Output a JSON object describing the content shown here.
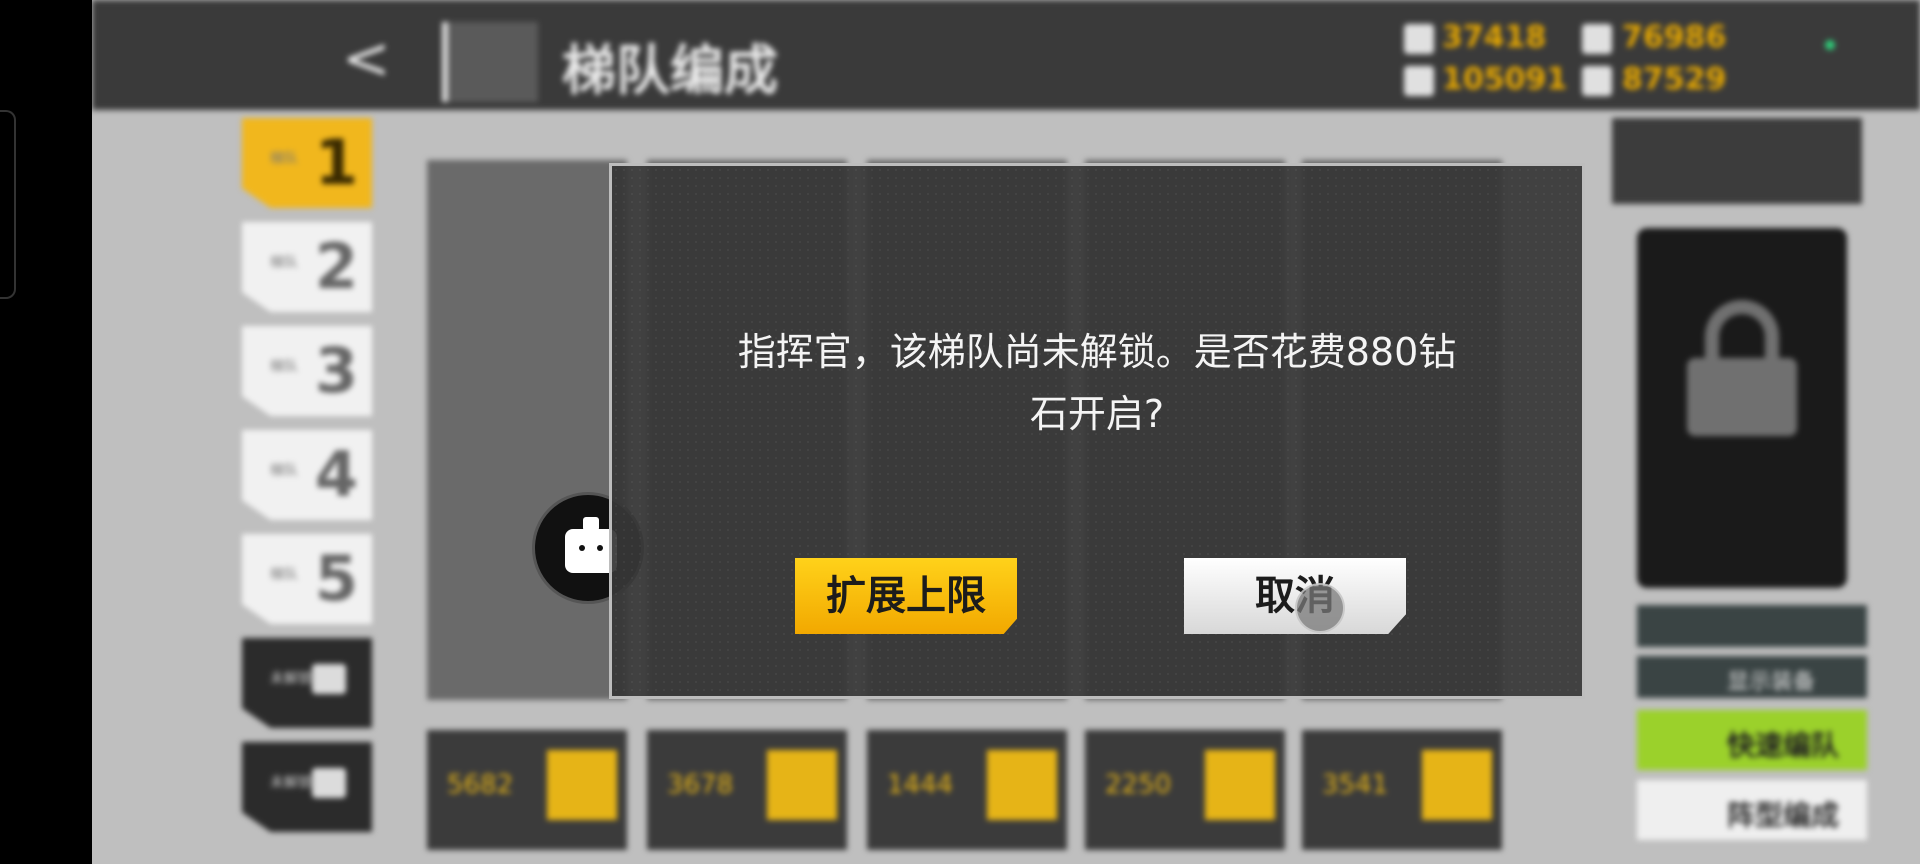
{
  "header": {
    "back_label": "<",
    "title": "梯队编成",
    "resources": [
      {
        "icon": "manpower-icon",
        "value": "37418"
      },
      {
        "icon": "ammo-icon",
        "value": "76986"
      },
      {
        "icon": "ration-icon",
        "value": "105091"
      },
      {
        "icon": "parts-icon",
        "value": "87529"
      }
    ]
  },
  "echelons": [
    {
      "label": "梯队",
      "number": "1",
      "active": true
    },
    {
      "label": "梯队",
      "number": "2"
    },
    {
      "label": "梯队",
      "number": "3"
    },
    {
      "label": "梯队",
      "number": "4"
    },
    {
      "label": "梯队",
      "number": "5"
    },
    {
      "label": "未解锁",
      "number": ""
    },
    {
      "label": "未解锁",
      "number": ""
    }
  ],
  "cards": [
    {
      "value": "5682"
    },
    {
      "value": "3678"
    },
    {
      "value": "1444"
    },
    {
      "value": "2250"
    },
    {
      "value": "3541"
    }
  ],
  "right_panel": {
    "show_equipment": "显示装备",
    "quick_form": "快速编队",
    "formation": "阵型编成"
  },
  "dialog": {
    "message_line1": "指挥官，该梯队尚未解锁。是否花费880钻",
    "message_line2": "石开启?",
    "confirm_label": "扩展上限",
    "cancel_label": "取消"
  },
  "colors": {
    "accent_yellow": "#f2b400",
    "quick_green": "#9bd12b",
    "dialog_bg": "#373737"
  }
}
